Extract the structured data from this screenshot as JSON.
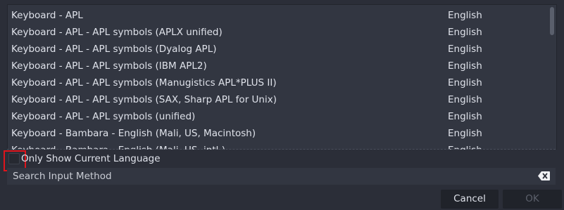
{
  "input_methods": {
    "items": [
      {
        "name": "Keyboard - APL",
        "language": "English"
      },
      {
        "name": "Keyboard - APL - APL symbols (APLX unified)",
        "language": "English"
      },
      {
        "name": "Keyboard - APL - APL symbols (Dyalog APL)",
        "language": "English"
      },
      {
        "name": "Keyboard - APL - APL symbols (IBM APL2)",
        "language": "English"
      },
      {
        "name": "Keyboard - APL - APL symbols (Manugistics APL*PLUS II)",
        "language": "English"
      },
      {
        "name": "Keyboard - APL - APL symbols (SAX, Sharp APL for Unix)",
        "language": "English"
      },
      {
        "name": "Keyboard - APL - APL symbols (unified)",
        "language": "English"
      },
      {
        "name": "Keyboard - Bambara - English (Mali, US, Macintosh)",
        "language": "English"
      },
      {
        "name": "Keyboard - Bambara - English (Mali, US, intl.)",
        "language": "English"
      }
    ]
  },
  "filter": {
    "only_current_language_label": "Only Show Current Language",
    "only_current_language_checked": false
  },
  "search": {
    "placeholder": "Search Input Method",
    "value": ""
  },
  "buttons": {
    "cancel_label": "Cancel",
    "ok_label": "OK",
    "ok_enabled": false
  },
  "icons": {
    "clear": "backspace-clear-icon"
  },
  "colors": {
    "background": "#2b2e38",
    "panel": "#323641",
    "text": "#dfe2ea",
    "highlight_box": "#e0141c",
    "disabled_text": "#5c606b"
  }
}
